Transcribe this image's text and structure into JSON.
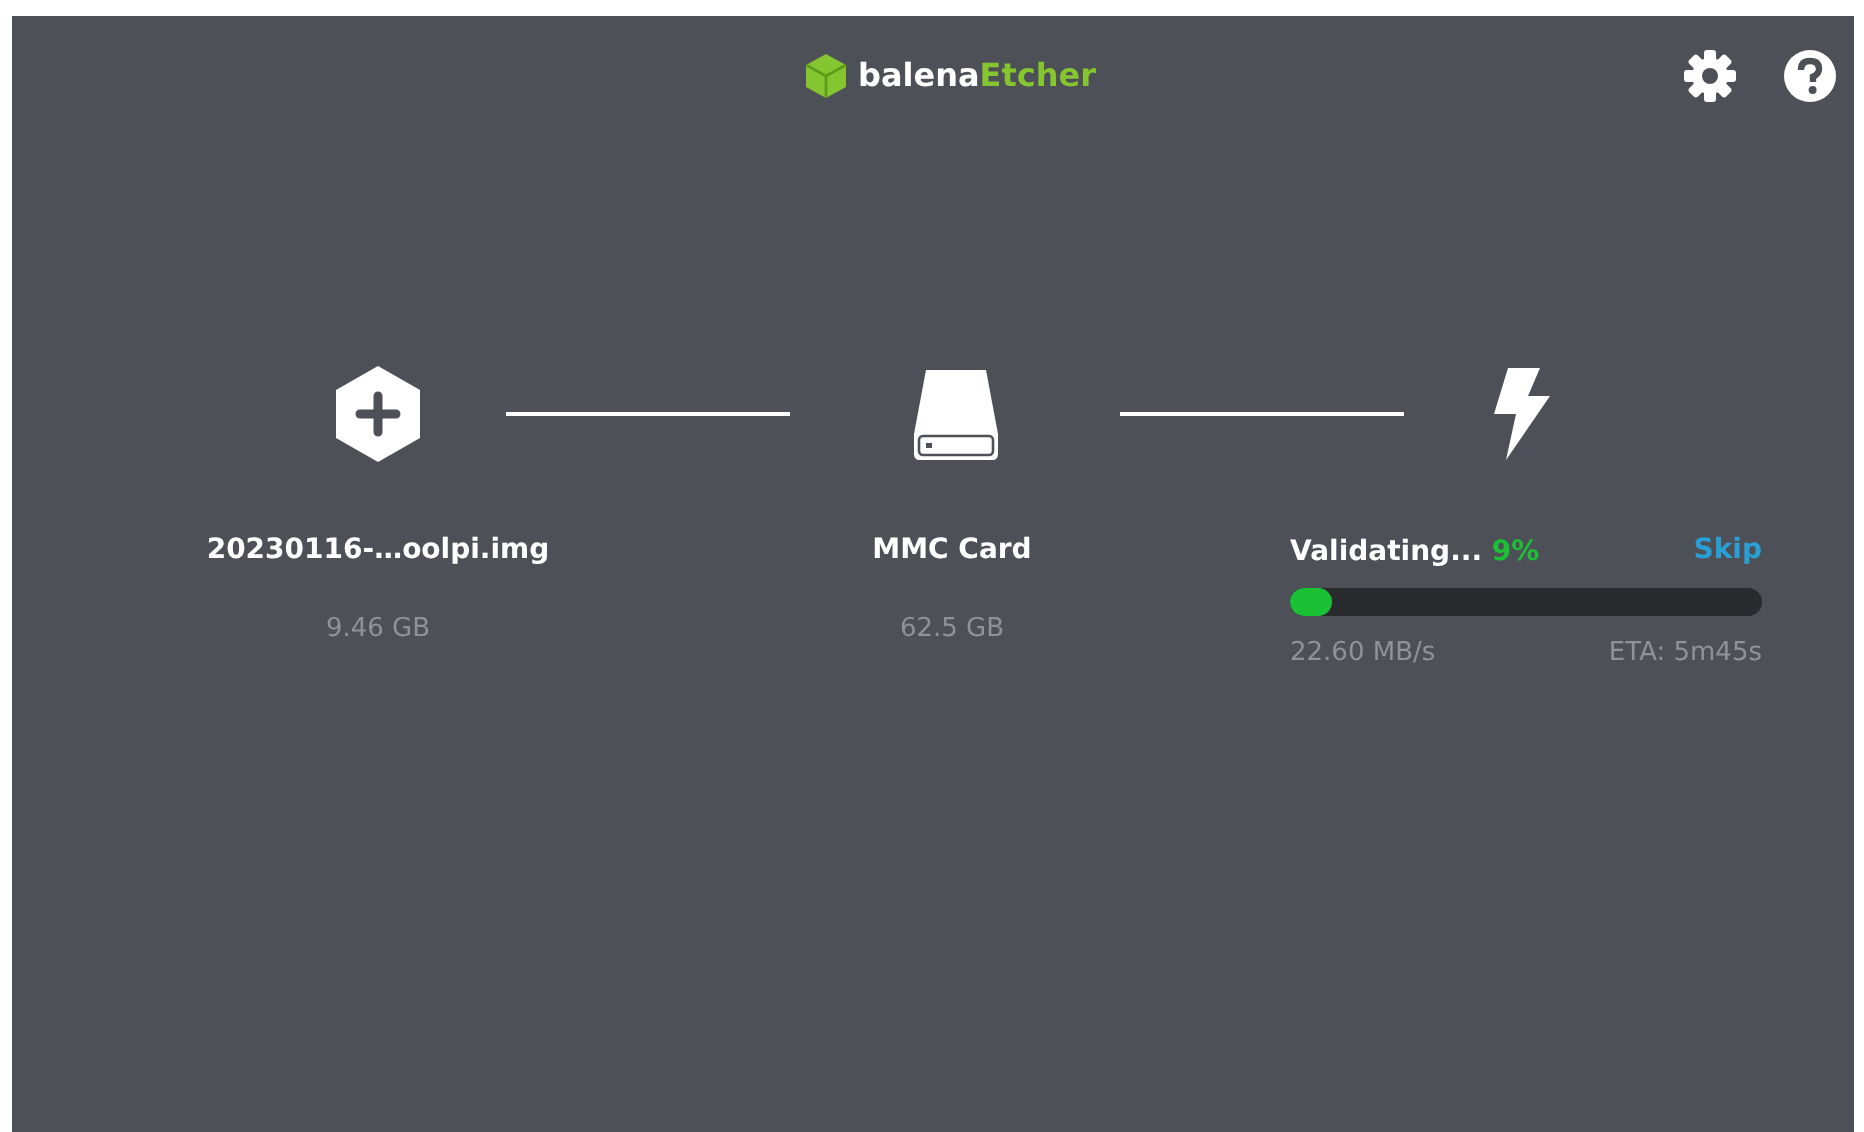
{
  "header": {
    "logo_text": "balena",
    "logo_accent": "Etcher"
  },
  "steps": [
    {
      "kind": "image",
      "label": "20230116-…oolpi.img",
      "size": "9.46 GB"
    },
    {
      "kind": "drive",
      "label": "MMC Card",
      "size": "62.5 GB"
    },
    {
      "kind": "flash",
      "status": "Validating...",
      "percent": "9%",
      "skip": "Skip",
      "level": 0.09,
      "speed": "22.60 MB/s",
      "eta": "ETA: 5m45s"
    }
  ]
}
